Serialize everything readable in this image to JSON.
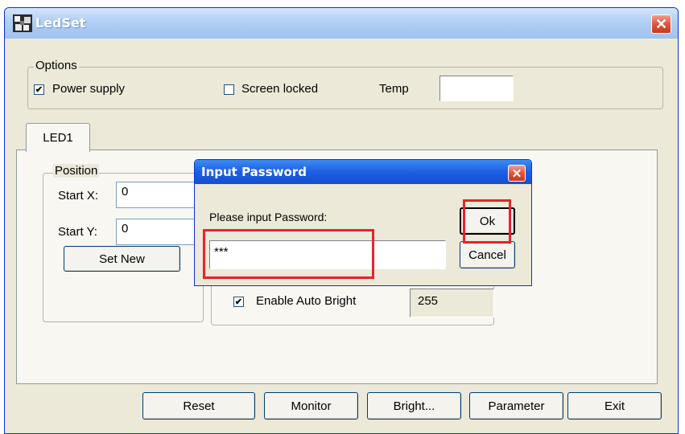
{
  "window": {
    "title": "LedSet",
    "close_icon": "close-icon"
  },
  "options": {
    "legend": "Options",
    "power_supply": {
      "label": "Power supply",
      "checked": true
    },
    "screen_locked": {
      "label": "Screen locked",
      "checked": false
    },
    "temp": {
      "label": "Temp",
      "value": ""
    }
  },
  "tabs": [
    {
      "label": "LED1"
    }
  ],
  "position": {
    "legend": "Position",
    "start_x": {
      "label": "Start X:",
      "value": "0"
    },
    "start_y": {
      "label": "Start Y:",
      "value": "0"
    },
    "set_new_label": "Set New"
  },
  "bright": {
    "enable_auto_bright": {
      "label": "Enable Auto Bright",
      "checked": true
    },
    "value": "255"
  },
  "footer_buttons": {
    "reset": "Reset",
    "monitor": "Monitor",
    "bright": "Bright...",
    "parameter": "Parameter",
    "exit": "Exit"
  },
  "dialog": {
    "title": "Input Password",
    "prompt": "Please input Password:",
    "password_value": "***",
    "ok_label": "Ok",
    "cancel_label": "Cancel"
  },
  "colors": {
    "highlight_box": "#e8232a",
    "dialog_title_bg": "#1d5ee3",
    "window_bg": "#ece9d8"
  }
}
